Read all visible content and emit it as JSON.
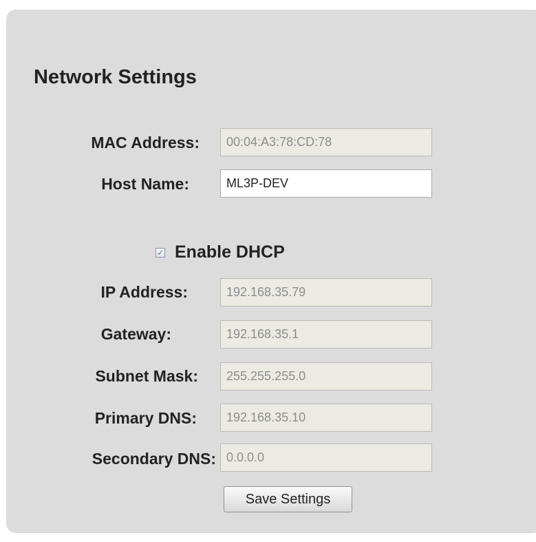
{
  "section": {
    "title": "Network Settings"
  },
  "host": {
    "mac_label": "MAC Address:",
    "mac_value": "00:04:A3:78:CD:78",
    "hostname_label": "Host Name:",
    "hostname_value": "ML3P-DEV"
  },
  "dhcp": {
    "label": "Enable DHCP",
    "checked": true,
    "check_glyph": "✓"
  },
  "network": {
    "ip_label": "IP Address:",
    "ip_value": "192.168.35.79",
    "gateway_label": "Gateway:",
    "gateway_value": "192.168.35.1",
    "subnet_label": "Subnet Mask:",
    "subnet_value": "255.255.255.0",
    "primary_dns_label": "Primary DNS:",
    "primary_dns_value": "192.168.35.10",
    "secondary_dns_label": "Secondary DNS:",
    "secondary_dns_value": "0.0.0.0"
  },
  "actions": {
    "save_label": "Save Settings"
  },
  "colors": {
    "panel_background": "#dcdcdc",
    "disabled_field_background": "#ebebe4",
    "disabled_field_text": "#8c8c8c",
    "checkbox_check": "#5b74a8"
  }
}
